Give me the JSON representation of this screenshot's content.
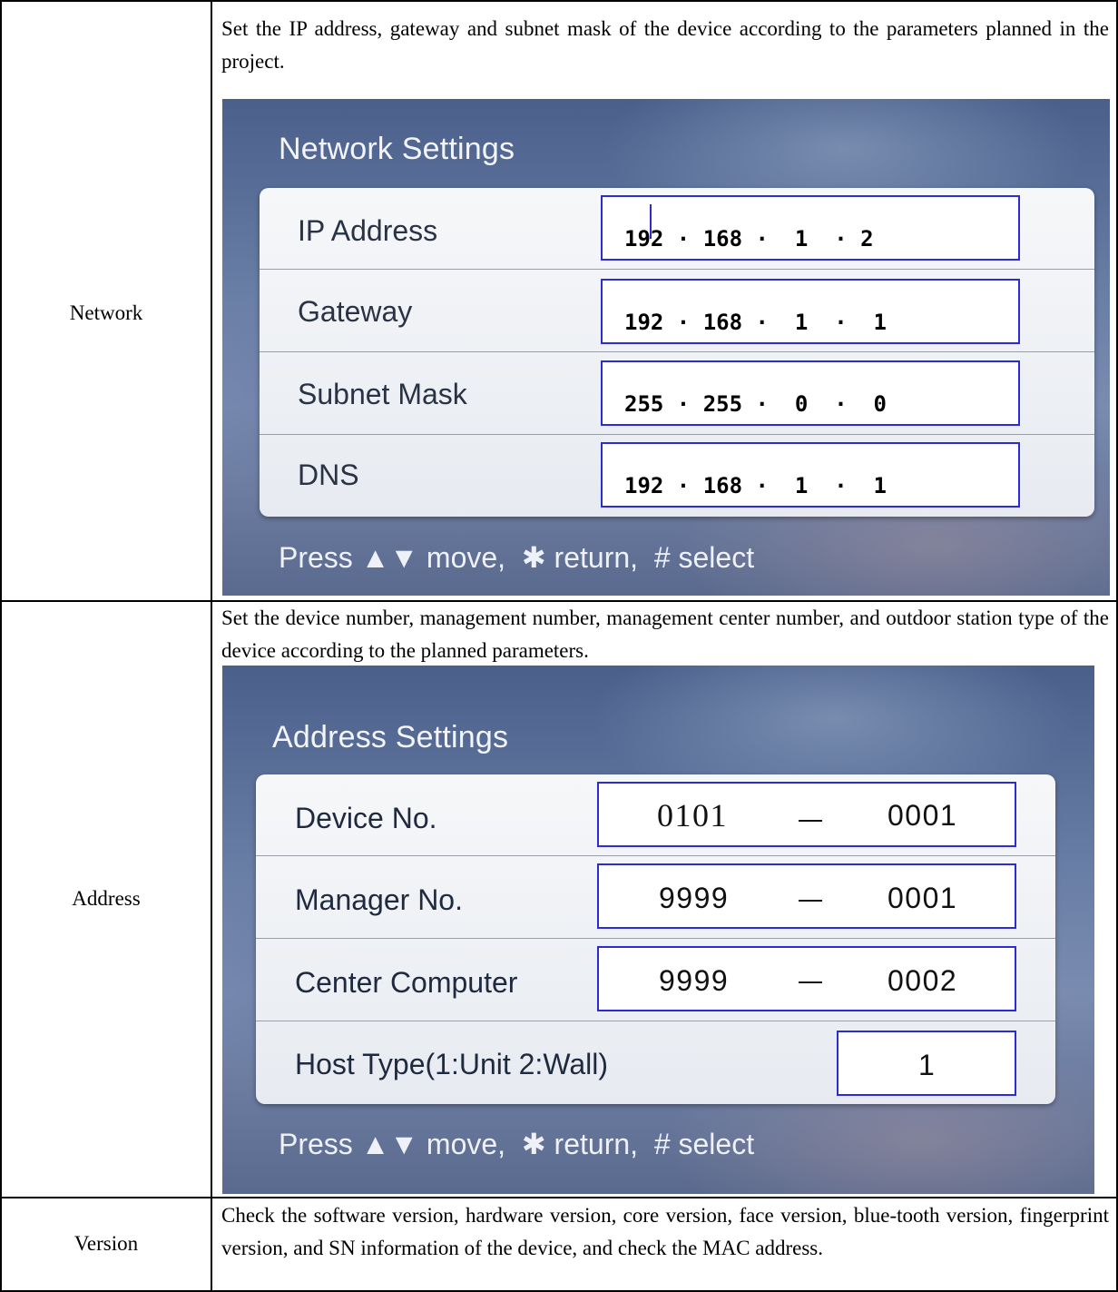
{
  "rows": [
    {
      "label": "Network",
      "description": "Set the IP address, gateway and subnet mask of the device according to the parameters planned in the project.",
      "screen": {
        "title": "Network Settings",
        "fields": [
          {
            "name": "IP Address",
            "value": "192 · 168 ·  1  · 2"
          },
          {
            "name": "Gateway",
            "value": "192 · 168 ·  1  ·  1"
          },
          {
            "name": "Subnet Mask",
            "value": "255 · 255 ·  0  ·  0"
          },
          {
            "name": "DNS",
            "value": "192 · 168 ·  1  ·  1"
          }
        ],
        "hint": "Press ▲▼ move,  ✱ return,  # select"
      }
    },
    {
      "label": "Address",
      "description": "Set the device number, management number, management center number, and outdoor station type of the device according to the planned parameters.",
      "screen": {
        "title": "Address Settings",
        "fields": [
          {
            "name": "Device No.",
            "left": "0101",
            "right": "0001"
          },
          {
            "name": "Manager No.",
            "left": "9999",
            "right": "0001"
          },
          {
            "name": "Center Computer",
            "left": "9999",
            "right": "0002"
          },
          {
            "name": "Host Type(1:Unit  2:Wall)",
            "value": "1"
          }
        ],
        "hint": "Press ▲▼ move,  ✱ return,  # select"
      }
    },
    {
      "label": "Version",
      "description": "Check the software version, hardware version, core version, face version, blue-tooth version, fingerprint version, and SN information of the device, and check the MAC address."
    }
  ]
}
